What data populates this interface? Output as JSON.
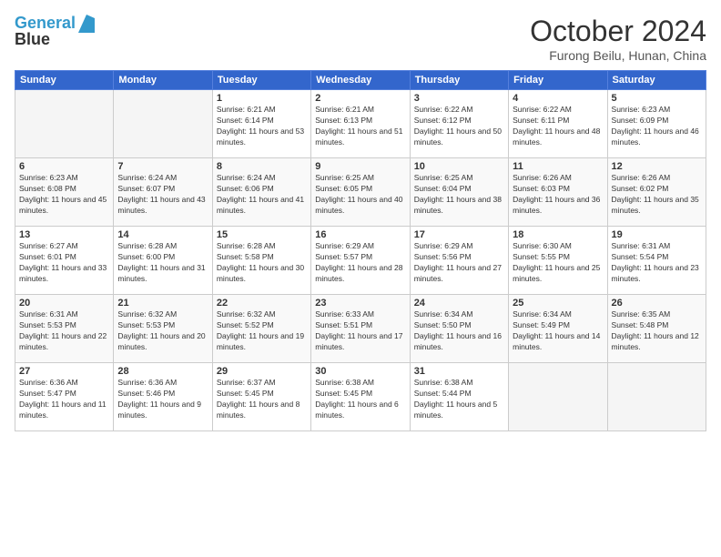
{
  "header": {
    "logo_line1": "General",
    "logo_line2": "Blue",
    "month_title": "October 2024",
    "location": "Furong Beilu, Hunan, China"
  },
  "weekdays": [
    "Sunday",
    "Monday",
    "Tuesday",
    "Wednesday",
    "Thursday",
    "Friday",
    "Saturday"
  ],
  "weeks": [
    [
      {
        "day": "",
        "empty": true
      },
      {
        "day": "",
        "empty": true
      },
      {
        "day": "1",
        "sunrise": "6:21 AM",
        "sunset": "6:14 PM",
        "daylight": "11 hours and 53 minutes."
      },
      {
        "day": "2",
        "sunrise": "6:21 AM",
        "sunset": "6:13 PM",
        "daylight": "11 hours and 51 minutes."
      },
      {
        "day": "3",
        "sunrise": "6:22 AM",
        "sunset": "6:12 PM",
        "daylight": "11 hours and 50 minutes."
      },
      {
        "day": "4",
        "sunrise": "6:22 AM",
        "sunset": "6:11 PM",
        "daylight": "11 hours and 48 minutes."
      },
      {
        "day": "5",
        "sunrise": "6:23 AM",
        "sunset": "6:09 PM",
        "daylight": "11 hours and 46 minutes."
      }
    ],
    [
      {
        "day": "6",
        "sunrise": "6:23 AM",
        "sunset": "6:08 PM",
        "daylight": "11 hours and 45 minutes."
      },
      {
        "day": "7",
        "sunrise": "6:24 AM",
        "sunset": "6:07 PM",
        "daylight": "11 hours and 43 minutes."
      },
      {
        "day": "8",
        "sunrise": "6:24 AM",
        "sunset": "6:06 PM",
        "daylight": "11 hours and 41 minutes."
      },
      {
        "day": "9",
        "sunrise": "6:25 AM",
        "sunset": "6:05 PM",
        "daylight": "11 hours and 40 minutes."
      },
      {
        "day": "10",
        "sunrise": "6:25 AM",
        "sunset": "6:04 PM",
        "daylight": "11 hours and 38 minutes."
      },
      {
        "day": "11",
        "sunrise": "6:26 AM",
        "sunset": "6:03 PM",
        "daylight": "11 hours and 36 minutes."
      },
      {
        "day": "12",
        "sunrise": "6:26 AM",
        "sunset": "6:02 PM",
        "daylight": "11 hours and 35 minutes."
      }
    ],
    [
      {
        "day": "13",
        "sunrise": "6:27 AM",
        "sunset": "6:01 PM",
        "daylight": "11 hours and 33 minutes."
      },
      {
        "day": "14",
        "sunrise": "6:28 AM",
        "sunset": "6:00 PM",
        "daylight": "11 hours and 31 minutes."
      },
      {
        "day": "15",
        "sunrise": "6:28 AM",
        "sunset": "5:58 PM",
        "daylight": "11 hours and 30 minutes."
      },
      {
        "day": "16",
        "sunrise": "6:29 AM",
        "sunset": "5:57 PM",
        "daylight": "11 hours and 28 minutes."
      },
      {
        "day": "17",
        "sunrise": "6:29 AM",
        "sunset": "5:56 PM",
        "daylight": "11 hours and 27 minutes."
      },
      {
        "day": "18",
        "sunrise": "6:30 AM",
        "sunset": "5:55 PM",
        "daylight": "11 hours and 25 minutes."
      },
      {
        "day": "19",
        "sunrise": "6:31 AM",
        "sunset": "5:54 PM",
        "daylight": "11 hours and 23 minutes."
      }
    ],
    [
      {
        "day": "20",
        "sunrise": "6:31 AM",
        "sunset": "5:53 PM",
        "daylight": "11 hours and 22 minutes."
      },
      {
        "day": "21",
        "sunrise": "6:32 AM",
        "sunset": "5:53 PM",
        "daylight": "11 hours and 20 minutes."
      },
      {
        "day": "22",
        "sunrise": "6:32 AM",
        "sunset": "5:52 PM",
        "daylight": "11 hours and 19 minutes."
      },
      {
        "day": "23",
        "sunrise": "6:33 AM",
        "sunset": "5:51 PM",
        "daylight": "11 hours and 17 minutes."
      },
      {
        "day": "24",
        "sunrise": "6:34 AM",
        "sunset": "5:50 PM",
        "daylight": "11 hours and 16 minutes."
      },
      {
        "day": "25",
        "sunrise": "6:34 AM",
        "sunset": "5:49 PM",
        "daylight": "11 hours and 14 minutes."
      },
      {
        "day": "26",
        "sunrise": "6:35 AM",
        "sunset": "5:48 PM",
        "daylight": "11 hours and 12 minutes."
      }
    ],
    [
      {
        "day": "27",
        "sunrise": "6:36 AM",
        "sunset": "5:47 PM",
        "daylight": "11 hours and 11 minutes."
      },
      {
        "day": "28",
        "sunrise": "6:36 AM",
        "sunset": "5:46 PM",
        "daylight": "11 hours and 9 minutes."
      },
      {
        "day": "29",
        "sunrise": "6:37 AM",
        "sunset": "5:45 PM",
        "daylight": "11 hours and 8 minutes."
      },
      {
        "day": "30",
        "sunrise": "6:38 AM",
        "sunset": "5:45 PM",
        "daylight": "11 hours and 6 minutes."
      },
      {
        "day": "31",
        "sunrise": "6:38 AM",
        "sunset": "5:44 PM",
        "daylight": "11 hours and 5 minutes."
      },
      {
        "day": "",
        "empty": true
      },
      {
        "day": "",
        "empty": true
      }
    ]
  ]
}
